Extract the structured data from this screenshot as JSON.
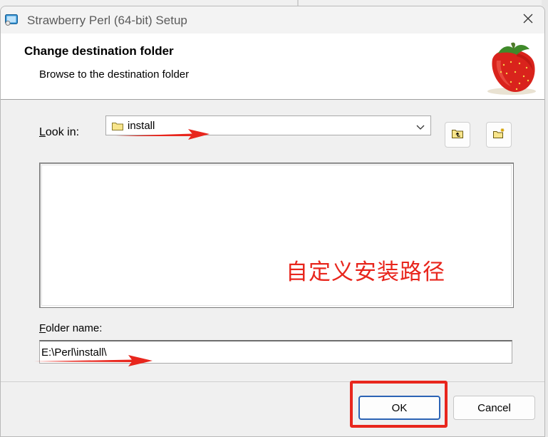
{
  "window": {
    "title": "Strawberry Perl (64-bit) Setup",
    "close_glyph": "✕"
  },
  "header": {
    "title": "Change destination folder",
    "subtitle": "Browse to the destination folder"
  },
  "look_in": {
    "label_accel": "L",
    "label_rest": "ook in:",
    "selected": "install"
  },
  "folder_name": {
    "label_accel": "F",
    "label_rest": "older name:",
    "value": "E:\\Perl\\install\\"
  },
  "annotation": {
    "text": "自定义安装路径",
    "color": "#e8261d"
  },
  "buttons": {
    "ok": "OK",
    "cancel": "Cancel"
  },
  "icons": {
    "app": "setup-icon",
    "close": "close-icon",
    "combo_folder": "folder-icon",
    "dropdown": "chevron-down-icon",
    "up_folder": "up-one-level-icon",
    "new_folder": "new-folder-icon",
    "logo": "strawberry-logo"
  },
  "colors": {
    "accent": "#2b63b5",
    "annotation_red": "#e8261d"
  }
}
